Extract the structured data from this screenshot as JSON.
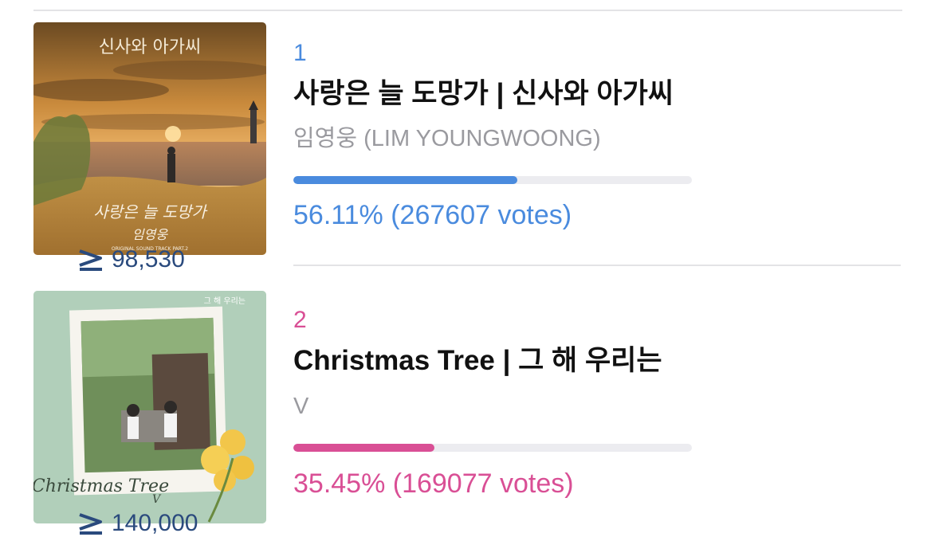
{
  "polls": [
    {
      "rank": "1",
      "title": "사랑은 늘 도망가 | 신사와 아가씨",
      "artist": "임영웅 (LIM YOUNGWOONG)",
      "percent": 56.11,
      "vote_text": "56.11% (267607 votes)",
      "streams": "98,530",
      "color": "#4a8bde",
      "art": {
        "logo": "신사와 아가씨",
        "handwritten_title": "사랑은 늘 도망가",
        "handwritten_artist": "임영웅",
        "caption": "ORIGINAL SOUND TRACK PART.2"
      }
    },
    {
      "rank": "2",
      "title": "Christmas Tree | 그 해 우리는",
      "artist": "V",
      "percent": 35.45,
      "vote_text": "35.45% (169077 votes)",
      "streams": "140,000",
      "color": "#d94f95",
      "art": {
        "logo": "그 해 우리는",
        "handwritten_title": "Christmas Tree",
        "handwritten_artist": "V"
      }
    }
  ],
  "colors": {
    "divider": "#e3e3e6",
    "bar_track": "#ececf0",
    "title": "#111111",
    "artist": "#9a9a9f",
    "streams": "#2a4a7d"
  }
}
